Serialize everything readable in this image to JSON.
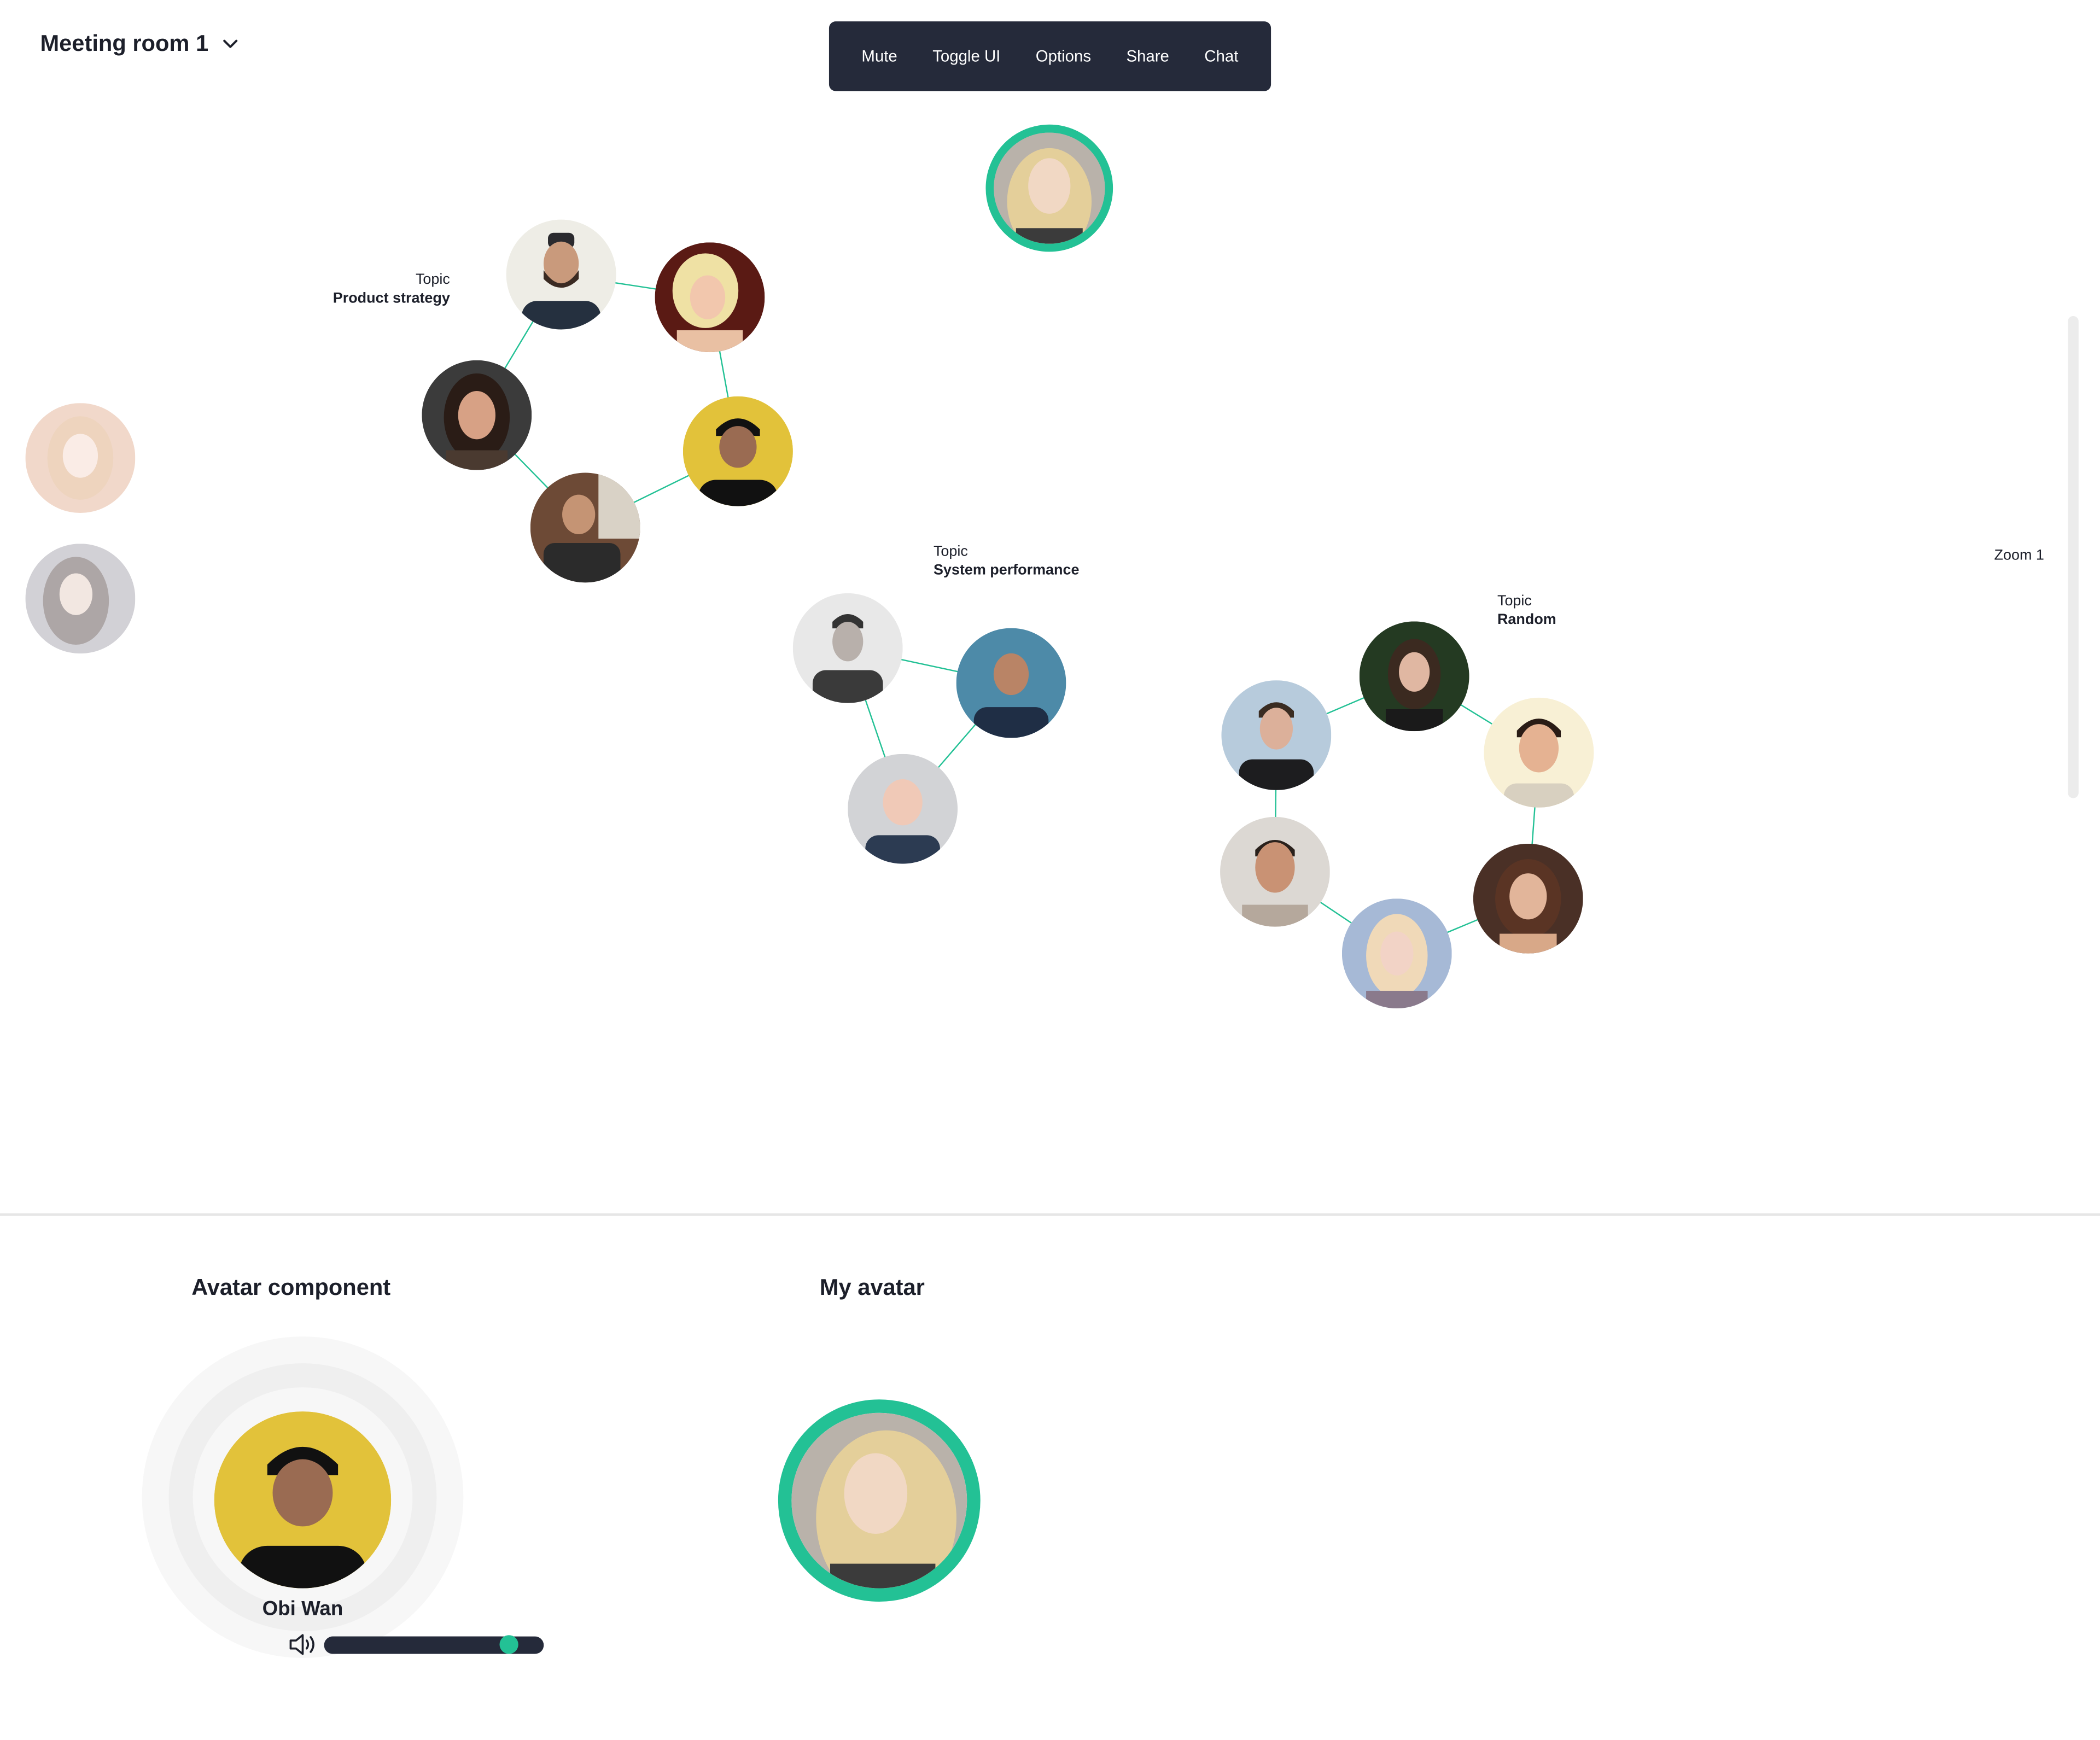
{
  "header": {
    "room_name": "Meeting room 1"
  },
  "toolbar": {
    "mute": "Mute",
    "toggle_ui": "Toggle UI",
    "options": "Options",
    "share": "Share",
    "chat": "Chat"
  },
  "topics": [
    {
      "label": "Topic",
      "name": "Product strategy"
    },
    {
      "label": "Topic",
      "name": "System performance"
    },
    {
      "label": "Topic",
      "name": "Random"
    }
  ],
  "zoom_label": "Zoom 1",
  "sections": {
    "avatar_component": "Avatar component",
    "my_avatar": "My avatar"
  },
  "avatar_component": {
    "name": "Obi Wan",
    "volume": 0.84
  },
  "colors": {
    "accent": "#23c195",
    "toolbar_bg": "#252a3a",
    "text": "#1c1f2a"
  }
}
